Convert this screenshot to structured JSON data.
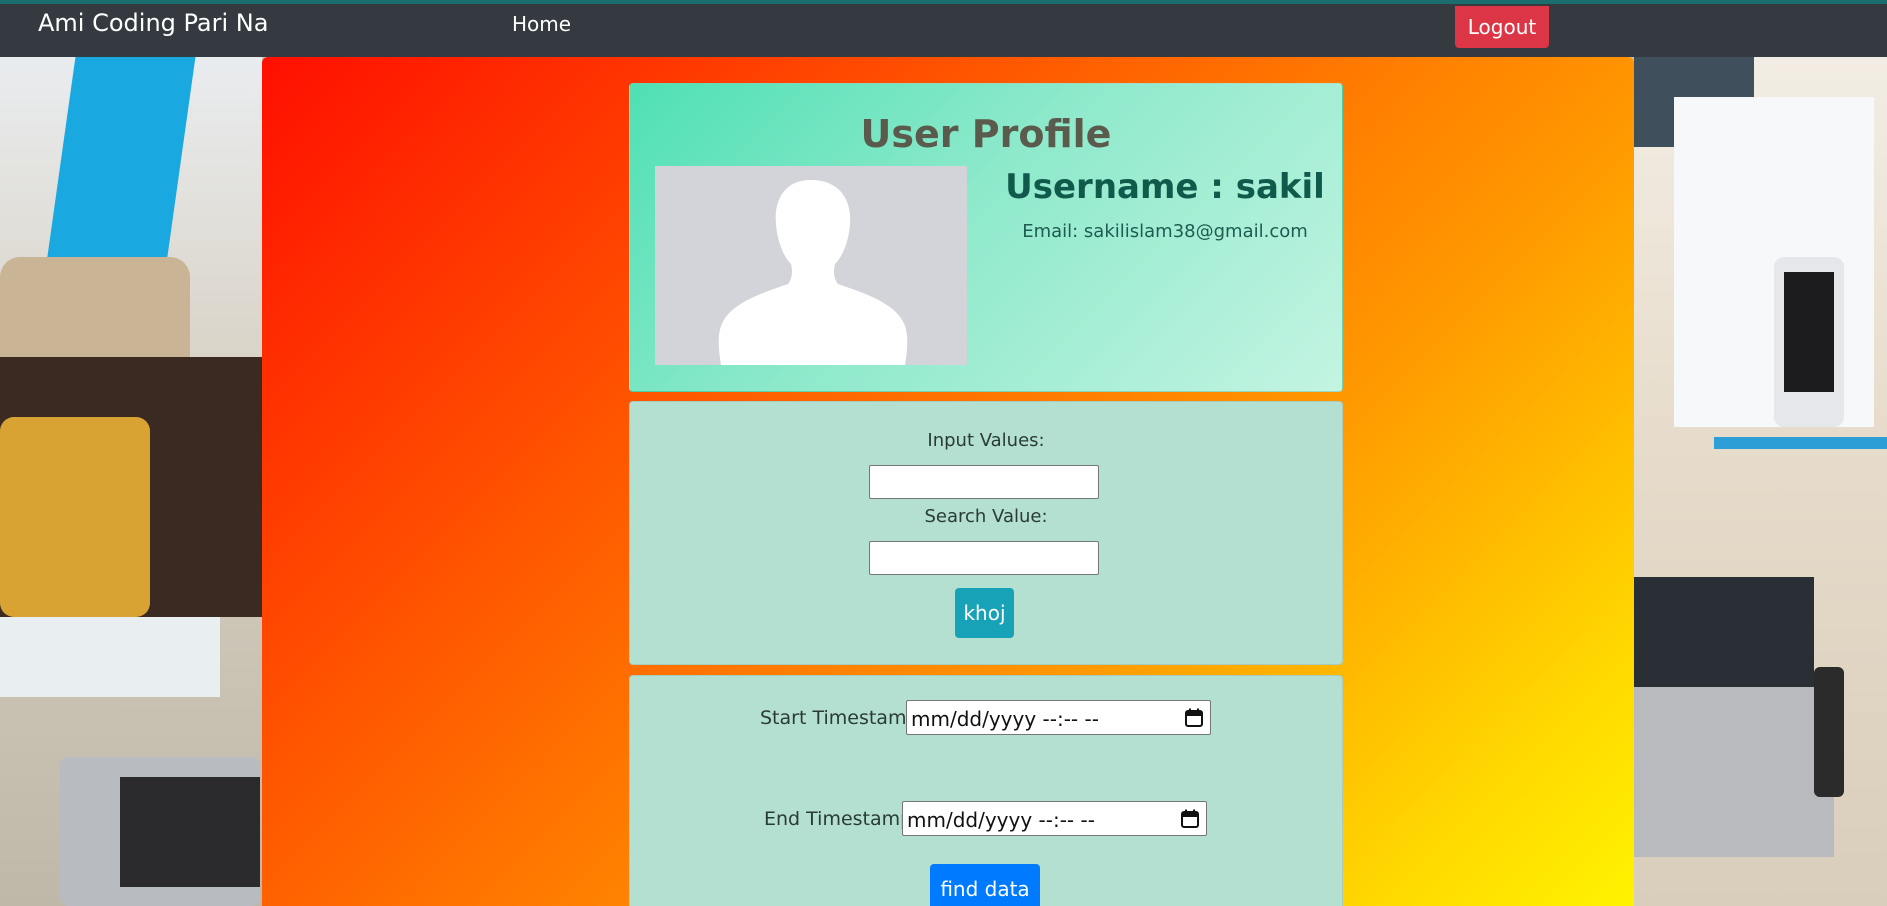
{
  "navbar": {
    "brand": "Ami Coding Pari Na",
    "home_label": "Home",
    "logout_label": "Logout"
  },
  "profile": {
    "title": "User Profile",
    "username_text": "Username : sakil",
    "email_text": "Email: sakilislam38@gmail.com",
    "avatar_icon": "person-silhouette-icon"
  },
  "search_form": {
    "input_values_label": "Input Values:",
    "input_values_value": "",
    "search_value_label": "Search Value:",
    "search_value_value": "",
    "submit_label": "khoj"
  },
  "timestamp_form": {
    "start_label": "Start Timestamp:",
    "start_placeholder": "mm/dd/yyyy --:-- --",
    "end_label": "End Timestamp:",
    "end_placeholder": "mm/dd/yyyy --:-- --",
    "calendar_icon": "calendar-icon",
    "submit_label": "find data"
  },
  "colors": {
    "navbar": "#343a40",
    "logout": "#dc3545",
    "khoj_button": "#17a2b8",
    "find_button": "#007bff",
    "card_bg": "#b4e0d1"
  }
}
